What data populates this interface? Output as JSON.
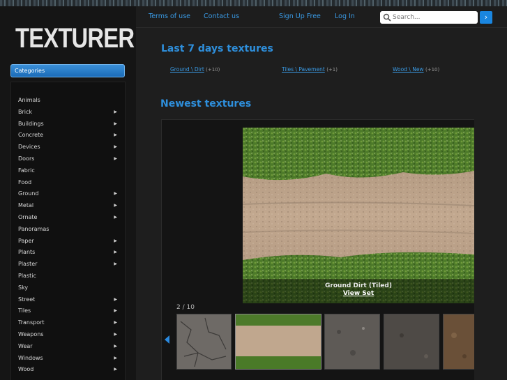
{
  "brand": {
    "logo_text": "TEXTURER"
  },
  "nav": {
    "terms": "Terms of use",
    "contact": "Contact us",
    "signup": "Sign Up Free",
    "login": "Log In",
    "search_placeholder": "Search...",
    "search_go": "›"
  },
  "sidebar": {
    "categories_label": "Categories",
    "items": [
      {
        "label": "Animals",
        "arrow": ""
      },
      {
        "label": "Brick",
        "arrow": "▶"
      },
      {
        "label": "Buildings",
        "arrow": "▶"
      },
      {
        "label": "Concrete",
        "arrow": "▶"
      },
      {
        "label": "Devices",
        "arrow": "▶"
      },
      {
        "label": "Doors",
        "arrow": "▶"
      },
      {
        "label": "Fabric",
        "arrow": ""
      },
      {
        "label": "Food",
        "arrow": ""
      },
      {
        "label": "Ground",
        "arrow": "▶"
      },
      {
        "label": "Metal",
        "arrow": "▶"
      },
      {
        "label": "Ornate",
        "arrow": "▶"
      },
      {
        "label": "Panoramas",
        "arrow": ""
      },
      {
        "label": "Paper",
        "arrow": "▶"
      },
      {
        "label": "Plants",
        "arrow": "▶"
      },
      {
        "label": "Plaster",
        "arrow": "▶"
      },
      {
        "label": "Plastic",
        "arrow": ""
      },
      {
        "label": "Sky",
        "arrow": ""
      },
      {
        "label": "Street",
        "arrow": "▶"
      },
      {
        "label": "Tiles",
        "arrow": "▶"
      },
      {
        "label": "Transport",
        "arrow": "▶"
      },
      {
        "label": "Weapons",
        "arrow": "▶"
      },
      {
        "label": "Wear",
        "arrow": "▶"
      },
      {
        "label": "Windows",
        "arrow": "▶"
      },
      {
        "label": "Wood",
        "arrow": "▶"
      }
    ]
  },
  "main": {
    "last7_title": "Last 7 days textures",
    "recent": [
      {
        "link": "Ground \\ Dirt",
        "count": "(+10)"
      },
      {
        "link": "Tiles \\ Pavement",
        "count": "(+1)"
      },
      {
        "link": "Wood \\ New",
        "count": "(+10)"
      }
    ],
    "newest_title": "Newest textures",
    "slideshow": {
      "caption_title": "Ground Dirt (Tiled)",
      "caption_link": "View Set",
      "counter": "2 / 10"
    }
  },
  "colors": {
    "accent": "#2e8fdc",
    "background": "#1e1e1e",
    "sidebar": "#151515"
  }
}
